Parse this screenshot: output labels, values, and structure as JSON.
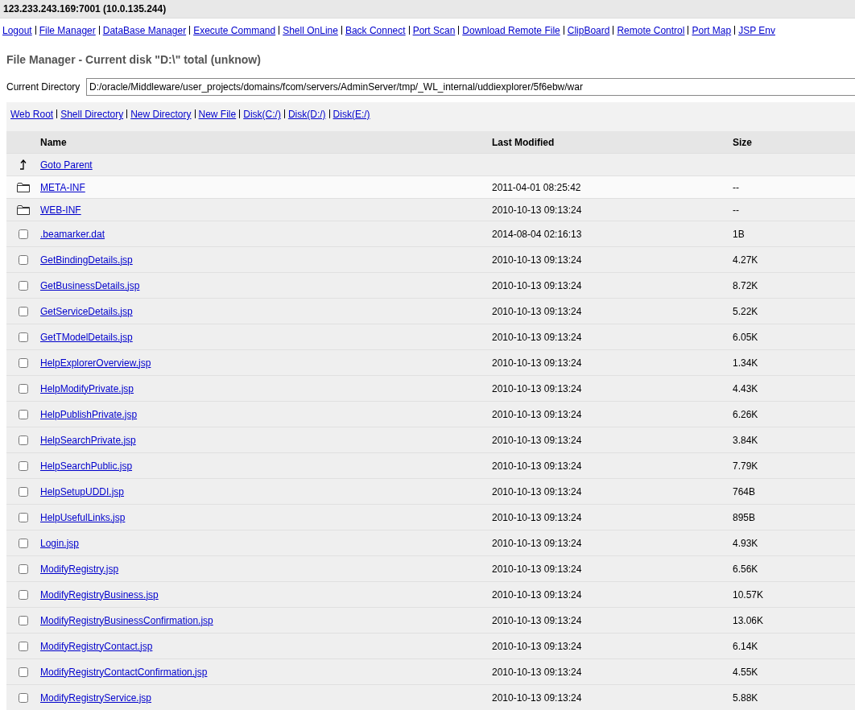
{
  "header": {
    "title": "123.233.243.169:7001 (10.0.135.244)"
  },
  "nav": [
    "Logout",
    "File Manager",
    "DataBase Manager",
    "Execute Command",
    "Shell OnLine",
    "Back Connect",
    "Port Scan",
    "Download Remote File",
    "ClipBoard",
    "Remote Control",
    "Port Map",
    "JSP Env"
  ],
  "page_title": "File Manager - Current disk \"D:\\\" total (unknow)",
  "current_directory": {
    "label": "Current Directory",
    "value": "D:/oracle/Middleware/user_projects/domains/fcom/servers/AdminServer/tmp/_WL_internal/uddiexplorer/5f6ebw/war"
  },
  "shortcuts": [
    "Web Root",
    "Shell Directory",
    "New Directory",
    "New File",
    "Disk(C:/)",
    "Disk(D:/)",
    "Disk(E:/)"
  ],
  "table": {
    "columns": [
      "Name",
      "Last Modified",
      "Size"
    ],
    "rows": [
      {
        "kind": "parent",
        "name": "Goto Parent"
      },
      {
        "kind": "folder",
        "name": "META-INF",
        "modified": "2011-04-01 08:25:42",
        "size": "--"
      },
      {
        "kind": "folder",
        "name": "WEB-INF",
        "modified": "2010-10-13 09:13:24",
        "size": "--"
      },
      {
        "kind": "file",
        "checked": false,
        "name": ".beamarker.dat",
        "modified": "2014-08-04 02:16:13",
        "size": "1B"
      },
      {
        "kind": "file",
        "checked": false,
        "name": "GetBindingDetails.jsp",
        "modified": "2010-10-13 09:13:24",
        "size": "4.27K"
      },
      {
        "kind": "file",
        "checked": false,
        "name": "GetBusinessDetails.jsp",
        "modified": "2010-10-13 09:13:24",
        "size": "8.72K"
      },
      {
        "kind": "file",
        "checked": false,
        "name": "GetServiceDetails.jsp",
        "modified": "2010-10-13 09:13:24",
        "size": "5.22K"
      },
      {
        "kind": "file",
        "checked": false,
        "name": "GetTModelDetails.jsp",
        "modified": "2010-10-13 09:13:24",
        "size": "6.05K"
      },
      {
        "kind": "file",
        "checked": false,
        "name": "HelpExplorerOverview.jsp",
        "modified": "2010-10-13 09:13:24",
        "size": "1.34K"
      },
      {
        "kind": "file",
        "checked": false,
        "name": "HelpModifyPrivate.jsp",
        "modified": "2010-10-13 09:13:24",
        "size": "4.43K"
      },
      {
        "kind": "file",
        "checked": false,
        "name": "HelpPublishPrivate.jsp",
        "modified": "2010-10-13 09:13:24",
        "size": "6.26K"
      },
      {
        "kind": "file",
        "checked": false,
        "name": "HelpSearchPrivate.jsp",
        "modified": "2010-10-13 09:13:24",
        "size": "3.84K"
      },
      {
        "kind": "file",
        "checked": false,
        "name": "HelpSearchPublic.jsp",
        "modified": "2010-10-13 09:13:24",
        "size": "7.79K"
      },
      {
        "kind": "file",
        "checked": false,
        "name": "HelpSetupUDDI.jsp",
        "modified": "2010-10-13 09:13:24",
        "size": "764B"
      },
      {
        "kind": "file",
        "checked": false,
        "name": "HelpUsefulLinks.jsp",
        "modified": "2010-10-13 09:13:24",
        "size": "895B"
      },
      {
        "kind": "file",
        "checked": false,
        "name": "Login.jsp",
        "modified": "2010-10-13 09:13:24",
        "size": "4.93K"
      },
      {
        "kind": "file",
        "checked": false,
        "name": "ModifyRegistry.jsp",
        "modified": "2010-10-13 09:13:24",
        "size": "6.56K"
      },
      {
        "kind": "file",
        "checked": false,
        "name": "ModifyRegistryBusiness.jsp",
        "modified": "2010-10-13 09:13:24",
        "size": "10.57K"
      },
      {
        "kind": "file",
        "checked": false,
        "name": "ModifyRegistryBusinessConfirmation.jsp",
        "modified": "2010-10-13 09:13:24",
        "size": "13.06K"
      },
      {
        "kind": "file",
        "checked": false,
        "name": "ModifyRegistryContact.jsp",
        "modified": "2010-10-13 09:13:24",
        "size": "6.14K"
      },
      {
        "kind": "file",
        "checked": false,
        "name": "ModifyRegistryContactConfirmation.jsp",
        "modified": "2010-10-13 09:13:24",
        "size": "4.55K"
      },
      {
        "kind": "file",
        "checked": false,
        "name": "ModifyRegistryService.jsp",
        "modified": "2010-10-13 09:13:24",
        "size": "5.88K"
      }
    ]
  }
}
